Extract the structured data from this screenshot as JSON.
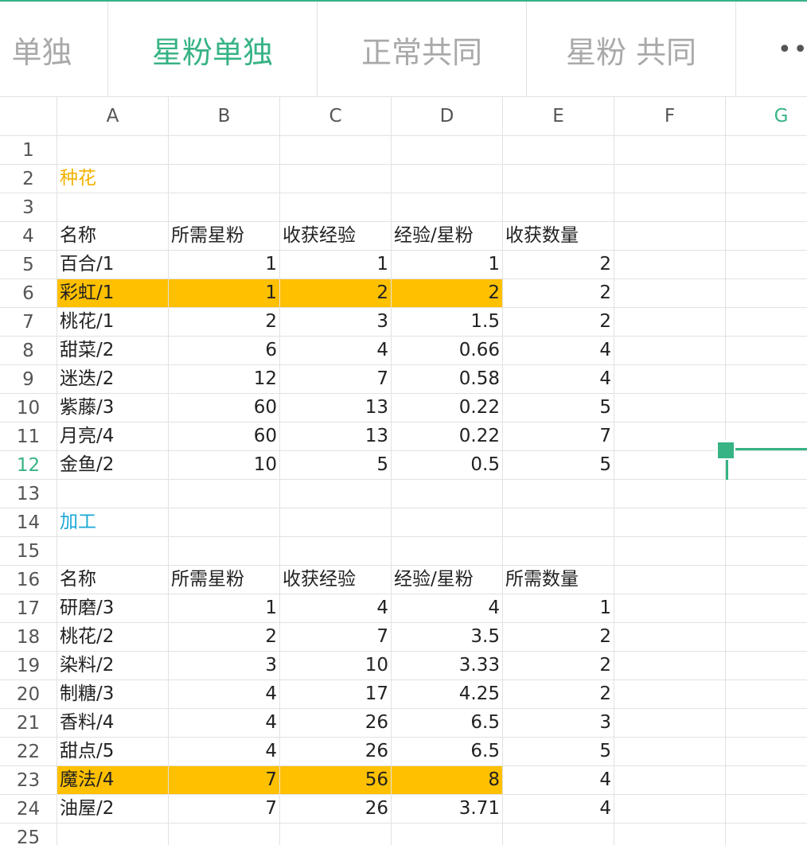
{
  "tabs": [
    {
      "label": "单独",
      "active": false
    },
    {
      "label": "星粉单独",
      "active": true
    },
    {
      "label": "正常共同",
      "active": false
    },
    {
      "label": "星粉 共同",
      "active": false
    },
    {
      "label": "••",
      "active": false
    }
  ],
  "columns": [
    "A",
    "B",
    "C",
    "D",
    "E",
    "F",
    "G"
  ],
  "active_column": "G",
  "active_row": 12,
  "rows": [
    {
      "n": 1,
      "cells": [
        "",
        "",
        "",
        "",
        ""
      ]
    },
    {
      "n": 2,
      "cells": [
        "种花",
        "",
        "",
        "",
        ""
      ],
      "style": "title-yellow"
    },
    {
      "n": 3,
      "cells": [
        "",
        "",
        "",
        "",
        ""
      ]
    },
    {
      "n": 4,
      "cells": [
        "名称",
        "所需星粉",
        "收获经验",
        "经验/星粉",
        "收获数量"
      ]
    },
    {
      "n": 5,
      "cells": [
        "百合/1",
        "1",
        "1",
        "1",
        "2"
      ]
    },
    {
      "n": 6,
      "cells": [
        "彩虹/1",
        "1",
        "2",
        "2",
        "2"
      ],
      "highlight": true
    },
    {
      "n": 7,
      "cells": [
        "桃花/1",
        "2",
        "3",
        "1.5",
        "2"
      ]
    },
    {
      "n": 8,
      "cells": [
        "甜菜/2",
        "6",
        "4",
        "0.66",
        "4"
      ]
    },
    {
      "n": 9,
      "cells": [
        "迷迭/2",
        "12",
        "7",
        "0.58",
        "4"
      ]
    },
    {
      "n": 10,
      "cells": [
        "紫藤/3",
        "60",
        "13",
        "0.22",
        "5"
      ]
    },
    {
      "n": 11,
      "cells": [
        "月亮/4",
        "60",
        "13",
        "0.22",
        "7"
      ]
    },
    {
      "n": 12,
      "cells": [
        "金鱼/2",
        "10",
        "5",
        "0.5",
        "5"
      ]
    },
    {
      "n": 13,
      "cells": [
        "",
        "",
        "",
        "",
        ""
      ]
    },
    {
      "n": 14,
      "cells": [
        "加工",
        "",
        "",
        "",
        ""
      ],
      "style": "title-blue"
    },
    {
      "n": 15,
      "cells": [
        "",
        "",
        "",
        "",
        ""
      ]
    },
    {
      "n": 16,
      "cells": [
        "名称",
        "所需星粉",
        "收获经验",
        "经验/星粉",
        "所需数量"
      ]
    },
    {
      "n": 17,
      "cells": [
        "研磨/3",
        "1",
        "4",
        "4",
        "1"
      ]
    },
    {
      "n": 18,
      "cells": [
        "桃花/2",
        "2",
        "7",
        "3.5",
        "2"
      ]
    },
    {
      "n": 19,
      "cells": [
        "染料/2",
        "3",
        "10",
        "3.33",
        "2"
      ]
    },
    {
      "n": 20,
      "cells": [
        "制糖/3",
        "4",
        "17",
        "4.25",
        "2"
      ]
    },
    {
      "n": 21,
      "cells": [
        "香料/4",
        "4",
        "26",
        "6.5",
        "3"
      ]
    },
    {
      "n": 22,
      "cells": [
        "甜点/5",
        "4",
        "26",
        "6.5",
        "5"
      ]
    },
    {
      "n": 23,
      "cells": [
        "魔法/4",
        "7",
        "56",
        "8",
        "4"
      ],
      "highlight": true
    },
    {
      "n": 24,
      "cells": [
        "油屋/2",
        "7",
        "26",
        "3.71",
        "4"
      ]
    },
    {
      "n": 25,
      "cells": [
        "",
        "",
        "",
        "",
        ""
      ]
    }
  ],
  "colors": {
    "accent": "#37b384",
    "highlight": "#ffc000",
    "title_yellow": "#f2b200",
    "title_blue": "#1aa7d8"
  }
}
